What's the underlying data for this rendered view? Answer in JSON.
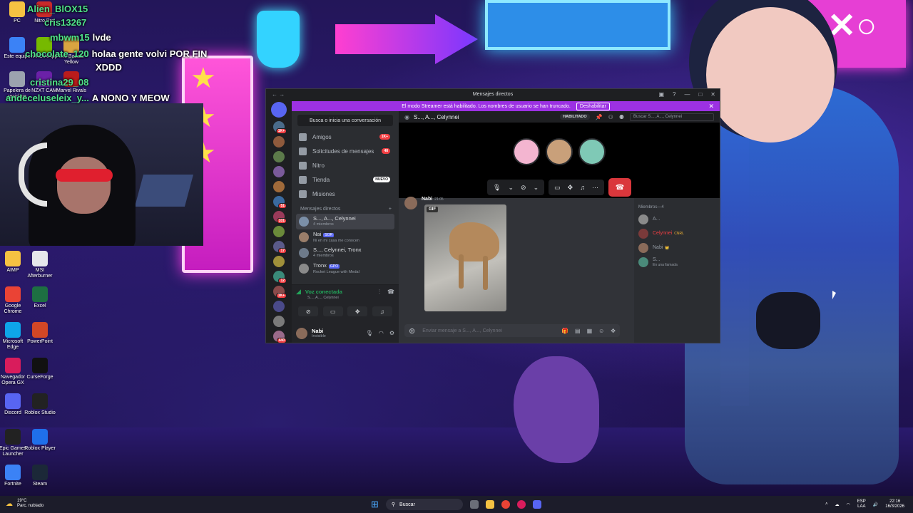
{
  "stream_chat": [
    {
      "user": "Alien_BlOX15",
      "message": ""
    },
    {
      "user": "cris13267",
      "message": ""
    },
    {
      "user": "mbwm15",
      "message": "lvde"
    },
    {
      "user": "chocolate_120",
      "message": "holaa gente volvi POR FIN"
    },
    {
      "user": "",
      "message": "XDDD"
    },
    {
      "user": "cristina29_08",
      "message": ""
    },
    {
      "user": "andeceluseleix_y...",
      "message": "A NONO Y MEOW"
    }
  ],
  "desktop_icons": {
    "top": [
      {
        "label": "PC",
        "icon": "folder-icon",
        "color": "#f5c242"
      },
      {
        "label": "Nitro Pro",
        "icon": "nitro-icon",
        "color": "#c92a2a"
      },
      {
        "label": "Este equipo",
        "icon": "computer-icon",
        "color": "#3b82f6"
      },
      {
        "label": "NVIDIA App",
        "icon": "nvidia-icon",
        "color": "#76b900"
      },
      {
        "label": "The Bazaar Yellow",
        "icon": "game-icon",
        "color": "#d9a441"
      },
      {
        "label": "Papelera de reciclaje",
        "icon": "recycle-bin-icon",
        "color": "#9ca3af"
      },
      {
        "label": "NZXT CAM",
        "icon": "nzxt-icon",
        "color": "#6b21a8"
      },
      {
        "label": "Marvel Rivals",
        "icon": "marvel-icon",
        "color": "#b91c1c"
      }
    ],
    "left": [
      {
        "label": "AIMP",
        "icon": "aimp-icon",
        "color": "#f5c242"
      },
      {
        "label": "MSI Afterburner",
        "icon": "msi-icon",
        "color": "#e5e7eb"
      },
      {
        "label": "Google Chrome",
        "icon": "chrome-icon",
        "color": "#ea4335"
      },
      {
        "label": "Excel",
        "icon": "excel-icon",
        "color": "#1d6f42"
      },
      {
        "label": "Microsoft Edge",
        "icon": "edge-icon",
        "color": "#0ea5e9"
      },
      {
        "label": "PowerPoint",
        "icon": "powerpoint-icon",
        "color": "#d24726"
      },
      {
        "label": "Navegador Opera GX",
        "icon": "opera-gx-icon",
        "color": "#d91c5c"
      },
      {
        "label": "CurseForge",
        "icon": "curseforge-icon",
        "color": "#111111"
      },
      {
        "label": "Discord",
        "icon": "discord-icon",
        "color": "#5865f2"
      },
      {
        "label": "Roblox Studio",
        "icon": "roblox-studio-icon",
        "color": "#222222"
      },
      {
        "label": "Epic Games Launcher",
        "icon": "epic-games-icon",
        "color": "#222222"
      },
      {
        "label": "Roblox Player",
        "icon": "roblox-player-icon",
        "color": "#1f6feb"
      },
      {
        "label": "Fortnite",
        "icon": "fortnite-icon",
        "color": "#3b82f6"
      },
      {
        "label": "Steam",
        "icon": "steam-icon",
        "color": "#1b2838"
      }
    ]
  },
  "discord": {
    "title": "Mensajes directos",
    "streamer_notice": "El modo Streamer está habilitado. Los nombres de usuario se han truncado.",
    "disable_button": "Deshabilitar",
    "dm_search": "Busca o inicia una conversación",
    "nav": [
      {
        "label": "Amigos",
        "badge": "1K+"
      },
      {
        "label": "Solicitudes de mensajes",
        "badge": "48"
      },
      {
        "label": "Nitro",
        "badge": ""
      },
      {
        "label": "Tienda",
        "badge": "NUEVO"
      },
      {
        "label": "Misiones",
        "badge": ""
      }
    ],
    "dm_header": "Mensajes directos",
    "dm_add": "+",
    "conversations": [
      {
        "name": "S..., A..., Celynnei",
        "sub": "4 miembros",
        "tag": "",
        "active": true,
        "color": "#7b8fa8"
      },
      {
        "name": "Nai",
        "sub": "Ni en mi casa me conocen",
        "tag": "SOR",
        "active": false,
        "color": "#9a7e6a"
      },
      {
        "name": "S..., Celynnei, Tronx",
        "sub": "4 miembros",
        "tag": "",
        "active": false,
        "color": "#6d7a8a"
      },
      {
        "name": "Tronx",
        "sub": "Rocket League with Medal",
        "tag": "GPO",
        "active": false,
        "color": "#8a8a8a"
      }
    ],
    "server_badges": [
      "1K+",
      "",
      "",
      "",
      "",
      "51",
      "101",
      "",
      "17",
      "",
      "12",
      "1K+",
      "",
      "",
      "440",
      "14",
      "",
      "NUEVO"
    ],
    "voice": {
      "status": "Voz conectada",
      "channel": "S..., A..., Celynnei"
    },
    "user": {
      "name": "Nabi",
      "status": "Invisible"
    },
    "channel_name": "S..., A..., Celynnei",
    "habilitado": "HABILITADO",
    "search_placeholder": "Buscar S..., A..., Celynnei",
    "call_avatars": [
      "#f3b5d0",
      "#c9a07a",
      "#7fc9b6"
    ],
    "message": {
      "author": "Nabi",
      "time": "21:05",
      "gif_label": "GIF"
    },
    "input_placeholder": "Enviar mensaje a S..., A..., Celynnei",
    "members_header": "Miembros—4",
    "members": [
      {
        "name": "A...",
        "sub": "",
        "red": false,
        "tag": ""
      },
      {
        "name": "Celynnei",
        "sub": "",
        "red": true,
        "tag": "CNRL"
      },
      {
        "name": "Nabi",
        "sub": "",
        "red": false,
        "tag": "👑"
      },
      {
        "name": "S...",
        "sub": "En una llamada",
        "red": false,
        "tag": ""
      }
    ]
  },
  "taskbar": {
    "weather_temp": "19°C",
    "weather_desc": "Parc. nublado",
    "search": "Buscar",
    "lang_top": "ESP",
    "lang_bottom": "LAA",
    "time": "22:16",
    "date": "16/3/2026"
  }
}
